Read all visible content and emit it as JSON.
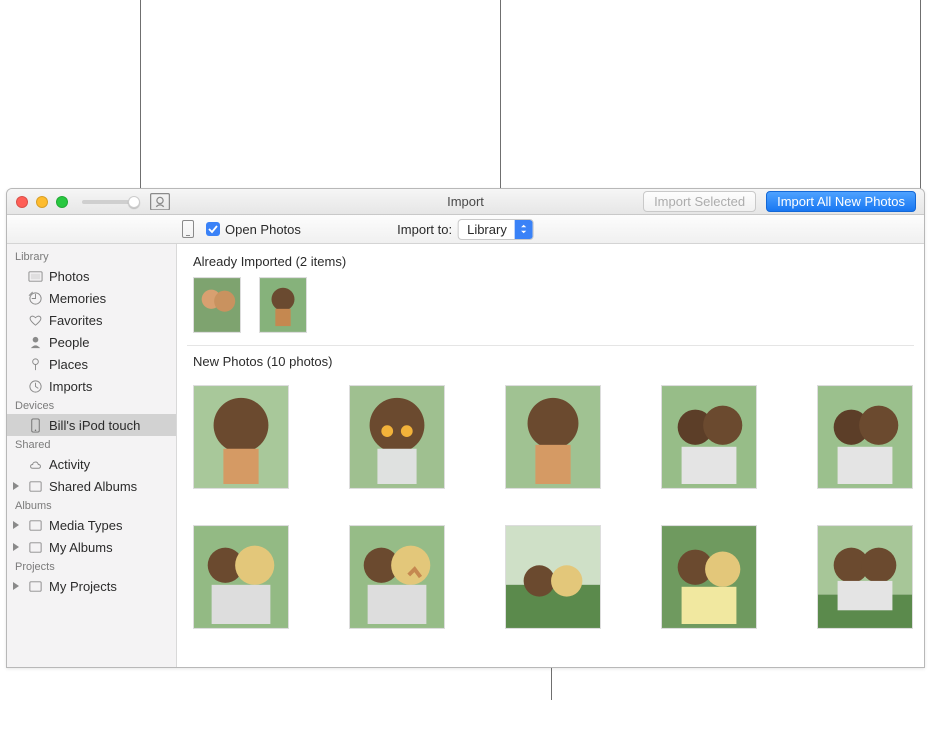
{
  "window_title": "Import",
  "titlebar": {
    "import_selected_label": "Import Selected",
    "import_all_label": "Import All New Photos"
  },
  "toolbar2": {
    "open_photos_label": "Open Photos",
    "import_to_label": "Import to:",
    "import_to_value": "Library"
  },
  "sidebar": {
    "library_header": "Library",
    "library_items": [
      {
        "label": "Photos",
        "icon": "photos"
      },
      {
        "label": "Memories",
        "icon": "memories"
      },
      {
        "label": "Favorites",
        "icon": "heart"
      },
      {
        "label": "People",
        "icon": "person"
      },
      {
        "label": "Places",
        "icon": "pin"
      },
      {
        "label": "Imports",
        "icon": "clock"
      }
    ],
    "devices_header": "Devices",
    "devices_items": [
      {
        "label": "Bill's iPod touch",
        "icon": "ipod",
        "selected": true
      }
    ],
    "shared_header": "Shared",
    "shared_items": [
      {
        "label": "Activity",
        "icon": "cloud"
      },
      {
        "label": "Shared Albums",
        "icon": "album",
        "tri": true
      }
    ],
    "albums_header": "Albums",
    "albums_items": [
      {
        "label": "Media Types",
        "icon": "album",
        "tri": true
      },
      {
        "label": "My Albums",
        "icon": "album",
        "tri": true
      }
    ],
    "projects_header": "Projects",
    "projects_items": [
      {
        "label": "My Projects",
        "icon": "album",
        "tri": true
      }
    ]
  },
  "content": {
    "already_imported_label": "Already Imported (2 items)",
    "new_photos_label": "New Photos (10 photos)"
  }
}
